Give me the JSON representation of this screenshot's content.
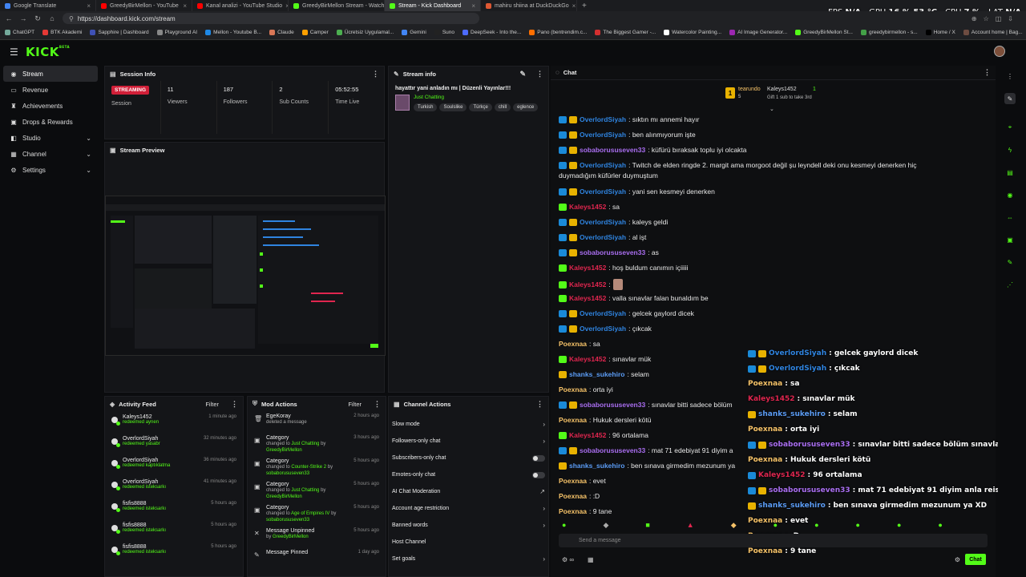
{
  "browser": {
    "tabs": [
      {
        "title": "Google Translate",
        "color": "#4285f4"
      },
      {
        "title": "GreedyBirMellon - YouTube",
        "color": "#ff0000"
      },
      {
        "title": "Kanal analizi - YouTube Studio",
        "color": "#ff0000"
      },
      {
        "title": "GreedyBirMellon Stream - Watch",
        "color": "#53fc18"
      },
      {
        "title": "Stream - Kick Dashboard",
        "color": "#53fc18"
      },
      {
        "title": "mahiru shiina at DuckDuckGo",
        "color": "#de5833"
      }
    ],
    "new_tab": "+",
    "url": "https://dashboard.kick.com/stream",
    "bookmarks": [
      "ChatGPT",
      "BTK Akademi",
      "Sapphire | Dashboard",
      "Playground AI",
      "Mellon - Youtube B...",
      "Claude",
      "Camper",
      "Ücretsiz Uygulamal...",
      "Gemini",
      "Suno",
      "DeepSeek - Into the...",
      "Pano (bentrendim.c...",
      "The Biggest Gamer -...",
      "Watercolor Painting...",
      "AI Image Generator...",
      "GreedyBirMellon St...",
      "greedybirmellon - s...",
      "Home / X",
      "Account home | Bag..."
    ],
    "bookmark_colors": [
      "#74aa9c",
      "#e53935",
      "#3f51b5",
      "#888888",
      "#1e88e5",
      "#d97757",
      "#ffa000",
      "#4caf50",
      "#4285f4",
      "#222222",
      "#4d6bfe",
      "#ff6f00",
      "#d32f2f",
      "#ffffff",
      "#9c27b0",
      "#53fc18",
      "#43a047",
      "#000000",
      "#6d4c41"
    ]
  },
  "hud": {
    "fps_label": "FPS",
    "fps": "N/A",
    "gpu_label": "GPU",
    "gpu": "16 %  53 °C",
    "cpu_label": "CPU",
    "cpu": "7 %",
    "lat_label": "LAT",
    "lat": "N/A"
  },
  "nav": {
    "items": [
      {
        "label": "Stream",
        "icon": "broadcast-icon",
        "glyph": "◉"
      },
      {
        "label": "Revenue",
        "icon": "wallet-icon",
        "glyph": "▭"
      },
      {
        "label": "Achievements",
        "icon": "trophy-icon",
        "glyph": "♜"
      },
      {
        "label": "Drops & Rewards",
        "icon": "gift-icon",
        "glyph": "▣"
      },
      {
        "label": "Studio",
        "icon": "studio-icon",
        "glyph": "◧"
      },
      {
        "label": "Channel",
        "icon": "channel-icon",
        "glyph": "▦"
      },
      {
        "label": "Settings",
        "icon": "gear-icon",
        "glyph": "⚙"
      }
    ]
  },
  "session": {
    "title": "Session Info",
    "live_badge": "STREAMING",
    "stats": [
      {
        "value": "",
        "label": "Session"
      },
      {
        "value": "11",
        "label": "Viewers"
      },
      {
        "value": "187",
        "label": "Followers"
      },
      {
        "value": "2",
        "label": "Sub Counts"
      },
      {
        "value": "05:52:55",
        "label": "Time Live"
      }
    ]
  },
  "preview": {
    "title": "Stream Preview"
  },
  "streaminfo": {
    "title": "Stream info",
    "stream_title": "hayattır yani anladın mı | Düzenli Yayınlar!!!",
    "category": "Just Chatting",
    "tags": [
      "Turkish",
      "Soulslike",
      "Türkçe",
      "chill",
      "eglence"
    ]
  },
  "activity": {
    "title": "Activity Feed",
    "filter": "Filter",
    "rows": [
      {
        "name": "Kaleys1452",
        "action": "redeemed",
        "reward": "aynen",
        "time": "1 minute ago"
      },
      {
        "name": "OverlordSiyah",
        "action": "redeemed",
        "reward": "yasabr",
        "time": "32 minutes ago"
      },
      {
        "name": "OverlordSiyah",
        "action": "redeemed",
        "reward": "kaptıklatma",
        "time": "36 minutes ago"
      },
      {
        "name": "OverlordSiyah",
        "action": "redeemed",
        "reward": "isteksarkı",
        "time": "41 minutes ago"
      },
      {
        "name": "fisfis8888",
        "action": "redeemed",
        "reward": "isteksarkı",
        "time": "5 hours ago"
      },
      {
        "name": "fisfis8888",
        "action": "redeemed",
        "reward": "isteksarkı",
        "time": "5 hours ago"
      },
      {
        "name": "fisfis8888",
        "action": "redeemed",
        "reward": "isteksarkı",
        "time": "5 hours ago"
      }
    ]
  },
  "mod": {
    "title": "Mod Actions",
    "filter": "Filter",
    "rows": [
      {
        "icon": "trash-icon",
        "glyph": "🗑",
        "title": "EgeKoray",
        "d1": "deleted a message",
        "g1": "",
        "d2": "",
        "g2": "",
        "time": "2 hours ago"
      },
      {
        "icon": "category-icon",
        "glyph": "▣",
        "title": "Category",
        "d1": "changed to",
        "g1": "Just Chatting",
        "d2": "by",
        "g2": "GreedyBirMellon",
        "time": "3 hours ago"
      },
      {
        "icon": "category-icon",
        "glyph": "▣",
        "title": "Category",
        "d1": "changed to",
        "g1": "Counter-Strike 2",
        "d2": "by",
        "g2": "sobaborususeven33",
        "time": "5 hours ago"
      },
      {
        "icon": "category-icon",
        "glyph": "▣",
        "title": "Category",
        "d1": "changed to",
        "g1": "Just Chatting",
        "d2": "by",
        "g2": "GreedyBirMellon",
        "time": "5 hours ago"
      },
      {
        "icon": "category-icon",
        "glyph": "▣",
        "title": "Category",
        "d1": "changed to",
        "g1": "Age of Empires IV",
        "d2": "by",
        "g2": "sobaborususeven33",
        "time": "5 hours ago"
      },
      {
        "icon": "unpin-icon",
        "glyph": "✕",
        "title": "Message Unpinned",
        "d1": "by",
        "g1": "GreedyBirMellon",
        "d2": "",
        "g2": "",
        "time": "5 hours ago"
      },
      {
        "icon": "pin-icon",
        "glyph": "✎",
        "title": "Message Pinned",
        "d1": "",
        "g1": "",
        "d2": "",
        "g2": "",
        "time": "1 day ago"
      }
    ]
  },
  "channel": {
    "title": "Channel Actions",
    "rows": [
      {
        "label": "Slow mode",
        "control": "chevron"
      },
      {
        "label": "Followers-only chat",
        "control": "chevron"
      },
      {
        "label": "Subscribers-only chat",
        "control": "toggle"
      },
      {
        "label": "Emotes-only chat",
        "control": "toggle"
      },
      {
        "label": "AI Chat Moderation",
        "control": "external"
      },
      {
        "label": "Account age restriction",
        "control": "chevron"
      },
      {
        "label": "Banned words",
        "control": "chevron"
      },
      {
        "label": "Host Channel",
        "control": "none"
      },
      {
        "label": "Set goals",
        "control": "chevron"
      }
    ]
  },
  "chat": {
    "title": "Chat",
    "pinned": {
      "user1": "tearundo",
      "count1": "5",
      "user2": "Kaleys1452",
      "count2": "1",
      "gift_text": "Gift 1 sub to take 3rd"
    },
    "messages": [
      {
        "user": "OverlordSiyah",
        "color": "#2f84e0",
        "badges": [
          "b-blue",
          "b-gold"
        ],
        "text": ": sıktın mı annemi hayır"
      },
      {
        "user": "OverlordSiyah",
        "color": "#2f84e0",
        "badges": [
          "b-blue",
          "b-gold"
        ],
        "text": ": ben alınmıyorum işte"
      },
      {
        "user": "sobaborususeven33",
        "color": "#a96ef0",
        "badges": [
          "b-blue",
          "b-gold"
        ],
        "text": ": küfürü bıraksak toplu iyi olcakta"
      },
      {
        "user": "OverlordSiyah",
        "color": "#2f84e0",
        "badges": [
          "b-blue",
          "b-gold"
        ],
        "text": ": Twitch de elden ringde 2. margit ama morgoot değil şu leyndell deki onu kesmeyi denerken hiç"
      },
      {
        "user": "",
        "color": "#e8e8e8",
        "badges": [],
        "text": "duymadığım küfürler duymuştum"
      },
      {
        "user": "OverlordSiyah",
        "color": "#2f84e0",
        "badges": [
          "b-blue",
          "b-gold"
        ],
        "text": ": yani sen kesmeyi denerken"
      },
      {
        "user": "Kaleys1452",
        "color": "#e0264f",
        "badges": [
          "b-green"
        ],
        "text": ": sa"
      },
      {
        "user": "OverlordSiyah",
        "color": "#2f84e0",
        "badges": [
          "b-blue",
          "b-gold"
        ],
        "text": ": kaleys geldi"
      },
      {
        "user": "OverlordSiyah",
        "color": "#2f84e0",
        "badges": [
          "b-blue",
          "b-gold"
        ],
        "text": ": al işt"
      },
      {
        "user": "sobaborususeven33",
        "color": "#a96ef0",
        "badges": [
          "b-blue",
          "b-gold"
        ],
        "text": ": as"
      },
      {
        "user": "Kaleys1452",
        "color": "#e0264f",
        "badges": [
          "b-green"
        ],
        "text": ": hoş buldum canımın içiiiii"
      },
      {
        "user": "Kaleys1452",
        "color": "#e0264f",
        "badges": [
          "b-green"
        ],
        "text": ":"
      },
      {
        "user": "Kaleys1452",
        "color": "#e0264f",
        "badges": [
          "b-green"
        ],
        "text": ": valla sınavlar falan bunaldım be"
      },
      {
        "user": "OverlordSiyah",
        "color": "#2f84e0",
        "badges": [
          "b-blue",
          "b-gold"
        ],
        "text": ": gelcek gaylord dicek"
      },
      {
        "user": "OverlordSiyah",
        "color": "#2f84e0",
        "badges": [
          "b-blue",
          "b-gold"
        ],
        "text": ": çıkcak"
      },
      {
        "user": "Poexnaa",
        "color": "#f5c268",
        "badges": [],
        "text": ": sa"
      },
      {
        "user": "Kaleys1452",
        "color": "#e0264f",
        "badges": [
          "b-green"
        ],
        "text": ": sınavlar mük"
      },
      {
        "user": "shanks_sukehiro",
        "color": "#5b9cf5",
        "badges": [
          "b-gold"
        ],
        "text": ": selam"
      },
      {
        "user": "Poexnaa",
        "color": "#f5c268",
        "badges": [],
        "text": ": orta iyi"
      },
      {
        "user": "sobaborususeven33",
        "color": "#a96ef0",
        "badges": [
          "b-blue",
          "b-gold"
        ],
        "text": ": sınavlar bitti sadece bölüm"
      },
      {
        "user": "Poexnaa",
        "color": "#f5c268",
        "badges": [],
        "text": ": Hukuk dersleri kötü"
      },
      {
        "user": "Kaleys1452",
        "color": "#e0264f",
        "badges": [
          "b-green"
        ],
        "text": ": 96 ortalama"
      },
      {
        "user": "sobaborususeven33",
        "color": "#a96ef0",
        "badges": [
          "b-blue",
          "b-gold"
        ],
        "text": ": mat 71 edebiyat 91 diyim a"
      },
      {
        "user": "shanks_sukehiro",
        "color": "#5b9cf5",
        "badges": [
          "b-gold"
        ],
        "text": ": ben sınava girmedim mezunum ya"
      },
      {
        "user": "Poexnaa",
        "color": "#f5c268",
        "badges": [],
        "text": ": evet"
      },
      {
        "user": "Poexnaa",
        "color": "#f5c268",
        "badges": [],
        "text": ": :D"
      },
      {
        "user": "Poexnaa",
        "color": "#f5c268",
        "badges": [],
        "text": ": 9 tane"
      }
    ],
    "overlay": [
      {
        "user": "OverlordSiyah",
        "color": "#2f84e0",
        "badges": [
          "b-blue",
          "b-gold"
        ],
        "text": ": gelcek gaylord dicek"
      },
      {
        "user": "OverlordSiyah",
        "color": "#2f84e0",
        "badges": [
          "b-blue",
          "b-gold"
        ],
        "text": ": çıkcak"
      },
      {
        "user": "Poexnaa",
        "color": "#f5c268",
        "badges": [],
        "text": ": sa"
      },
      {
        "user": "Kaleys1452",
        "color": "#e0264f",
        "badges": [],
        "text": ": sınavlar mük"
      },
      {
        "user": "shanks_sukehiro",
        "color": "#5b9cf5",
        "badges": [
          "b-gold"
        ],
        "text": ": selam"
      },
      {
        "user": "Poexnaa",
        "color": "#f5c268",
        "badges": [],
        "text": ": orta iyi"
      },
      {
        "user": "sobaborususeven33",
        "color": "#a96ef0",
        "badges": [
          "b-blue",
          "b-gold"
        ],
        "text": ": sınavlar bitti sadece bölüm sınavları kaldı"
      },
      {
        "user": "Poexnaa",
        "color": "#f5c268",
        "badges": [],
        "text": ": Hukuk dersleri kötü"
      },
      {
        "user": "Kaleys1452",
        "color": "#e0264f",
        "badges": [
          "b-blue"
        ],
        "text": ": 96 ortalama"
      },
      {
        "user": "sobaborususeven33",
        "color": "#a96ef0",
        "badges": [
          "b-blue",
          "b-gold"
        ],
        "text": ": mat 71 edebiyat 91 diyim anla reis"
      },
      {
        "user": "shanks_sukehiro",
        "color": "#5b9cf5",
        "badges": [
          "b-gold"
        ],
        "text": ": ben sınava girmedim mezunum ya XD"
      },
      {
        "user": "Poexnaa",
        "color": "#f5c268",
        "badges": [],
        "text": ": evet"
      },
      {
        "user": "Poexnaa",
        "color": "#f5c268",
        "badges": [],
        "text": ": :D"
      },
      {
        "user": "Poexnaa",
        "color": "#f5c268",
        "badges": [],
        "text": ": 9 tane"
      }
    ],
    "input_placeholder": "Send a message",
    "send_label": "Chat"
  },
  "accent": "#53fc18"
}
